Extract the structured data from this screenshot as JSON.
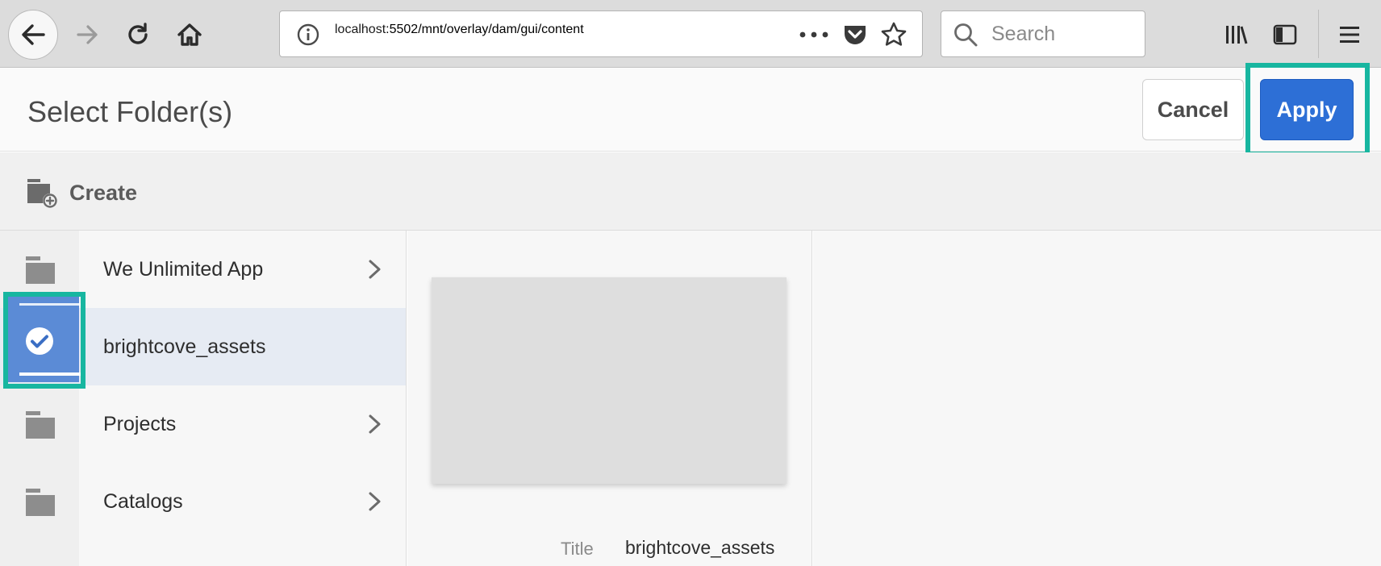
{
  "browser": {
    "url_host": "localhost",
    "url_path": ":5502/mnt/overlay/dam/gui/content",
    "search_placeholder": "Search",
    "icons": [
      "back-icon",
      "forward-icon",
      "reload-icon",
      "home-icon",
      "site-info-icon",
      "page-actions-icon",
      "pocket-icon",
      "bookmark-star-icon",
      "search-icon",
      "library-icon",
      "sidebar-icon",
      "hamburger-menu-icon"
    ]
  },
  "header": {
    "title": "Select Folder(s)",
    "cancel_label": "Cancel",
    "apply_label": "Apply"
  },
  "actions": {
    "create_label": "Create"
  },
  "folders": [
    {
      "label": "We Unlimited App",
      "has_children": true,
      "selected": false
    },
    {
      "label": "brightcove_assets",
      "has_children": false,
      "selected": true
    },
    {
      "label": "Projects",
      "has_children": true,
      "selected": false
    },
    {
      "label": "Catalogs",
      "has_children": true,
      "selected": false
    }
  ],
  "preview": {
    "meta_key": "Title",
    "meta_value": "brightcove_assets"
  },
  "colors": {
    "highlight": "#17b6a0",
    "primary": "#2d6fd6",
    "selection": "#5b8bd6"
  }
}
